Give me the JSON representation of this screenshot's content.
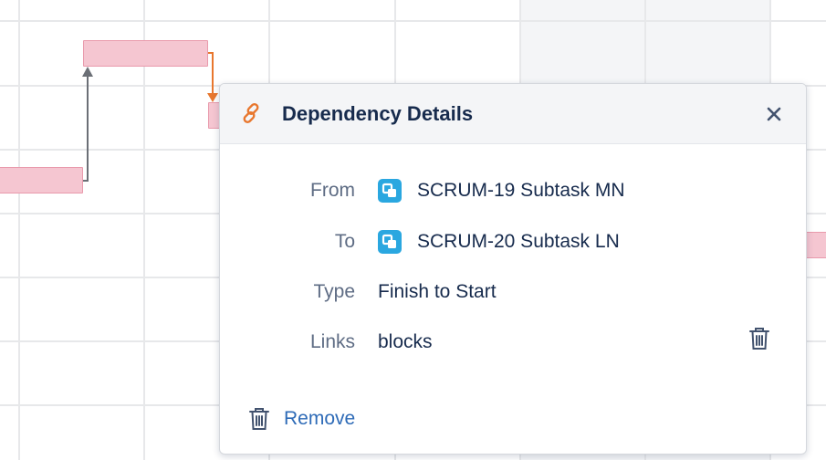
{
  "dialog": {
    "title": "Dependency Details",
    "close_glyph": "✕",
    "header_icon": "link-icon",
    "accent_color": "#e8772e",
    "fields": {
      "from": {
        "label": "From",
        "issue_key_and_title": "SCRUM-19 Subtask MN",
        "issue_icon": "subtask-icon"
      },
      "to": {
        "label": "To",
        "issue_key_and_title": "SCRUM-20 Subtask LN",
        "issue_icon": "subtask-icon"
      },
      "type": {
        "label": "Type",
        "value": "Finish to Start"
      },
      "links": {
        "label": "Links",
        "value": "blocks",
        "delete_icon": "trash-icon"
      }
    },
    "remove_label": "Remove",
    "colors": {
      "link_text": "#2e6bb7",
      "issue_icon": "#2aa7e0",
      "label_text": "#5e6c84",
      "value_text": "#172b4d"
    }
  },
  "gantt": {
    "bar_color": "#f5c6d1",
    "dependency_arrow_colors": [
      "#6b6f76",
      "#e8772e"
    ]
  }
}
